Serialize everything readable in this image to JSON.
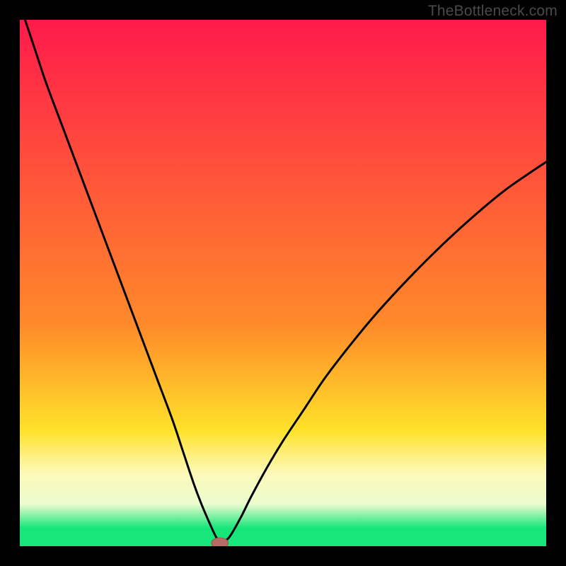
{
  "watermark": "TheBottleneck.com",
  "colors": {
    "frame": "#000000",
    "curve": "#000000",
    "marker_fill": "#b86a64",
    "marker_stroke": "#9d564f",
    "grad_top": "#ff1a4b",
    "grad_mid1": "#ff8a2a",
    "grad_mid2": "#ffe22a",
    "grad_band_light": "#fdf9b8",
    "grad_band_pale": "#ecfccf",
    "grad_bottom": "#17e67a"
  },
  "chart_data": {
    "type": "line",
    "title": "",
    "xlabel": "",
    "ylabel": "",
    "xlim": [
      0,
      100
    ],
    "ylim": [
      0,
      100
    ],
    "series": [
      {
        "name": "bottleneck-curve",
        "x": [
          1,
          3,
          5,
          8,
          11,
          14,
          17,
          20,
          23,
          26,
          29,
          31,
          33,
          34.5,
          36,
          37,
          37.5,
          38,
          38.5,
          39,
          40,
          42,
          44,
          47,
          50,
          54,
          58,
          63,
          68,
          74,
          80,
          86,
          92,
          97,
          100
        ],
        "y": [
          100,
          94,
          88,
          80,
          72,
          64,
          56,
          48,
          40,
          32,
          24,
          18,
          12,
          8,
          4.5,
          2.3,
          1.4,
          0.8,
          0.8,
          1.0,
          2.0,
          5.5,
          9.5,
          15,
          20,
          26,
          32,
          38.5,
          44.5,
          51,
          57,
          62.5,
          67.5,
          71,
          73
        ]
      }
    ],
    "marker": {
      "x": 38,
      "y": 0.6,
      "rx": 1.6,
      "ry": 1.0
    },
    "gradient_bands_pct_from_top": [
      0,
      58,
      78,
      86,
      92,
      96.5,
      100
    ]
  }
}
